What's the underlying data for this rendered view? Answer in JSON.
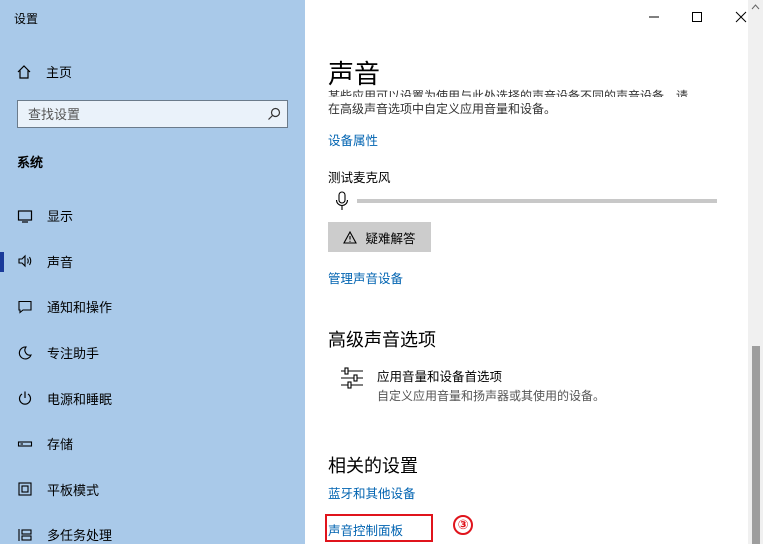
{
  "window": {
    "title": "设置"
  },
  "sidebar": {
    "home_label": "主页",
    "search_placeholder": "查找设置",
    "section_label": "系统",
    "items": [
      {
        "label": "显示",
        "icon": "display-icon"
      },
      {
        "label": "声音",
        "icon": "speaker-icon",
        "active": true
      },
      {
        "label": "通知和操作",
        "icon": "notification-icon"
      },
      {
        "label": "专注助手",
        "icon": "moon-icon"
      },
      {
        "label": "电源和睡眠",
        "icon": "power-icon"
      },
      {
        "label": "存储",
        "icon": "storage-icon"
      },
      {
        "label": "平板模式",
        "icon": "tablet-icon"
      },
      {
        "label": "多任务处理",
        "icon": "multitask-icon"
      }
    ]
  },
  "main": {
    "title": "声音",
    "desc_line1": "某些应用可以设置为使用与此处选择的声音设备不同的声音设备。请",
    "desc_line2": "在高级声音选项中自定义应用音量和设备。",
    "device_props_link": "设备属性",
    "mic_test_label": "测试麦克风",
    "troubleshoot_label": "疑难解答",
    "manage_devices_link": "管理声音设备",
    "advanced_title": "高级声音选项",
    "advanced_option_title": "应用音量和设备首选项",
    "advanced_option_sub": "自定义应用音量和扬声器或其使用的设备。",
    "related_title": "相关的设置",
    "bluetooth_link": "蓝牙和其他设备",
    "sound_control_link": "声音控制面板",
    "step_badge": "③"
  },
  "colors": {
    "sidebar_bg": "#a9c9e9",
    "link": "#0063b1",
    "highlight": "#e0141c"
  }
}
